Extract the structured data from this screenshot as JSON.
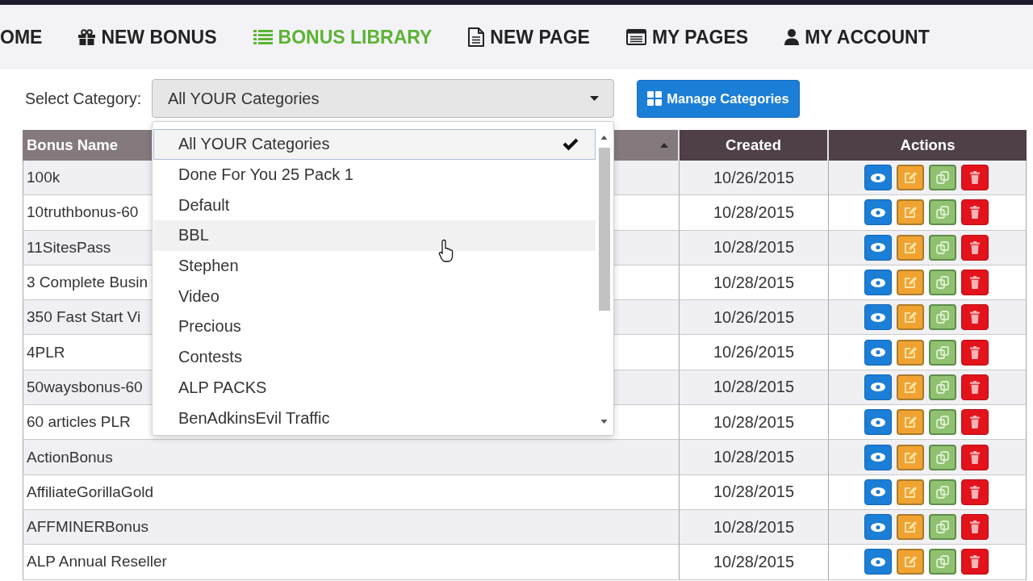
{
  "nav": {
    "items": [
      {
        "label": "OME",
        "selected": false
      },
      {
        "label": "NEW BONUS",
        "selected": false
      },
      {
        "label": "BONUS LIBRARY",
        "selected": true
      },
      {
        "label": "NEW PAGE",
        "selected": false
      },
      {
        "label": "MY PAGES",
        "selected": false
      },
      {
        "label": "MY ACCOUNT",
        "selected": false
      }
    ]
  },
  "category_filter": {
    "label": "Select Category:",
    "value": "All YOUR Categories",
    "expanded": true,
    "options": [
      {
        "label": "All YOUR Categories",
        "selected": true,
        "hovered": false
      },
      {
        "label": "Done For You 25 Pack 1",
        "selected": false,
        "hovered": false
      },
      {
        "label": "Default",
        "selected": false,
        "hovered": false
      },
      {
        "label": "BBL",
        "selected": false,
        "hovered": true
      },
      {
        "label": "Stephen",
        "selected": false,
        "hovered": false
      },
      {
        "label": "Video",
        "selected": false,
        "hovered": false
      },
      {
        "label": "Precious",
        "selected": false,
        "hovered": false
      },
      {
        "label": "Contests",
        "selected": false,
        "hovered": false
      },
      {
        "label": "ALP PACKS",
        "selected": false,
        "hovered": false
      },
      {
        "label": "BenAdkinsEvil Traffic",
        "selected": false,
        "hovered": false
      }
    ]
  },
  "manage_button": {
    "label": "Manage Categories"
  },
  "table": {
    "columns": [
      {
        "label": "Bonus Name",
        "sorted": true
      },
      {
        "label": "Created",
        "sorted": false
      },
      {
        "label": "Actions",
        "sorted": false
      }
    ],
    "row_actions": [
      {
        "kind": "view"
      },
      {
        "kind": "edit"
      },
      {
        "kind": "copy"
      },
      {
        "kind": "delete"
      }
    ],
    "rows": [
      {
        "bonus_name": "100k",
        "created": "10/26/2015"
      },
      {
        "bonus_name": "10truthbonus-60",
        "created": "10/28/2015"
      },
      {
        "bonus_name": "11SitesPass",
        "created": "10/28/2015"
      },
      {
        "bonus_name": "3 Complete Busin",
        "created": "10/28/2015"
      },
      {
        "bonus_name": "350 Fast Start Vi",
        "created": "10/26/2015"
      },
      {
        "bonus_name": "4PLR",
        "created": "10/26/2015"
      },
      {
        "bonus_name": "50waysbonus-60",
        "created": "10/28/2015"
      },
      {
        "bonus_name": "60 articles PLR",
        "created": "10/28/2015"
      },
      {
        "bonus_name": "ActionBonus",
        "created": "10/28/2015"
      },
      {
        "bonus_name": "AffiliateGorillaGold",
        "created": "10/28/2015"
      },
      {
        "bonus_name": "AFFMINERBonus",
        "created": "10/28/2015"
      },
      {
        "bonus_name": "ALP Annual Reseller",
        "created": "10/28/2015"
      }
    ]
  }
}
